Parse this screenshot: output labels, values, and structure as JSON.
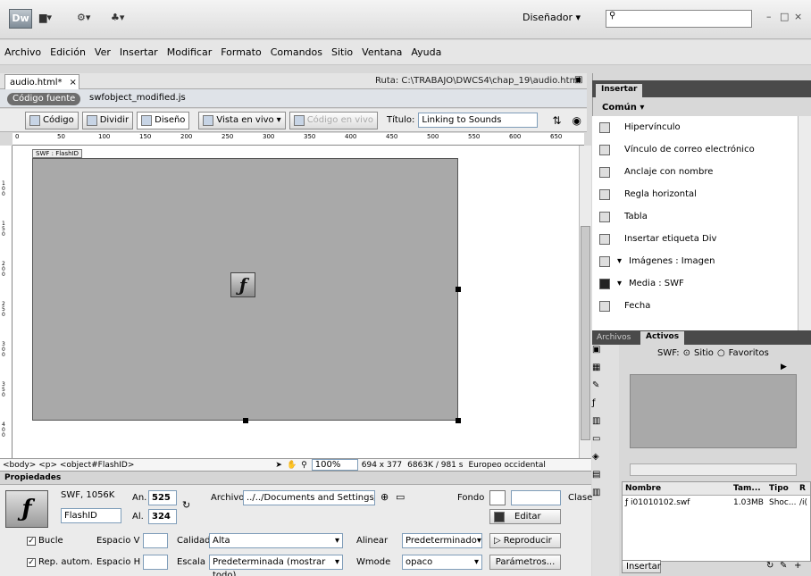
{
  "app": {
    "logo": "Dw",
    "workspace": "Diseñador"
  },
  "menu": [
    "Archivo",
    "Edición",
    "Ver",
    "Insertar",
    "Modificar",
    "Formato",
    "Comandos",
    "Sitio",
    "Ventana",
    "Ayuda"
  ],
  "doc": {
    "tab": "audio.html*",
    "close": "×",
    "path": "Ruta: C:\\TRABAJO\\DWCS4\\chap_19\\audio.html",
    "source_button": "Código fuente",
    "related_file": "swfobject_modified.js"
  },
  "toolbar": {
    "code": "Código",
    "split": "Dividir",
    "design": "Diseño",
    "live_view": "Vista en vivo",
    "live_code": "Código en vivo",
    "title_label": "Título:",
    "title_value": "Linking to Sounds"
  },
  "ruler": [
    "0",
    "50",
    "100",
    "150",
    "200",
    "250",
    "300",
    "350",
    "400",
    "450",
    "500",
    "550",
    "600",
    "650"
  ],
  "ruler_v": [
    "1 0 0",
    "1 5 0",
    "2 0 0",
    "2 5 0",
    "3 0 0",
    "3 5 0",
    "4 0 0",
    "4 5 0"
  ],
  "canvas": {
    "swf_label": "SWF : FlashID"
  },
  "tagbar": {
    "tags": "<body> <p> <object#FlashID>",
    "zoom": "100%",
    "size": "694 x 377",
    "weight": "6863K / 981 s",
    "encoding": "Europeo occidental"
  },
  "properties": {
    "header": "Propiedades",
    "swf": "SWF, 1056K",
    "id": "FlashID",
    "w_label": "An.",
    "w": "525",
    "h_label": "Al.",
    "h": "324",
    "file_label": "Archivo",
    "file": "../../Documents and Settings/#",
    "bg_label": "Fondo",
    "class_label": "Clase",
    "edit": "Editar",
    "loop": "Bucle",
    "autoplay": "Rep. autom.",
    "vspace": "Espacio V",
    "hspace": "Espacio H",
    "quality_label": "Calidad",
    "quality": "Alta",
    "scale_label": "Escala",
    "scale": "Predeterminada (mostrar todo)",
    "align_label": "Alinear",
    "align": "Predeterminado",
    "wmode_label": "Wmode",
    "wmode": "opaco",
    "play": "Reproducir",
    "params": "Parámetros..."
  },
  "insert": {
    "tab": "Insertar",
    "category": "Común",
    "items": [
      "Hipervínculo",
      "Vínculo de correo electrónico",
      "Anclaje con nombre",
      "Regla horizontal",
      "Tabla",
      "Insertar etiqueta Div",
      "Imágenes : Imagen",
      "Media : SWF",
      "Fecha"
    ]
  },
  "files": {
    "tab_files": "Archivos",
    "tab_assets": "Activos",
    "filter_label": "SWF:",
    "site": "Sitio",
    "favorites": "Favoritos",
    "cols": [
      "Nombre",
      "Tam...",
      "Tipo",
      "R"
    ],
    "row": {
      "name": "i01010102.swf",
      "size": "1.03MB",
      "type": "Shoc...",
      "r": "/i("
    },
    "insert_btn": "Insertar"
  }
}
